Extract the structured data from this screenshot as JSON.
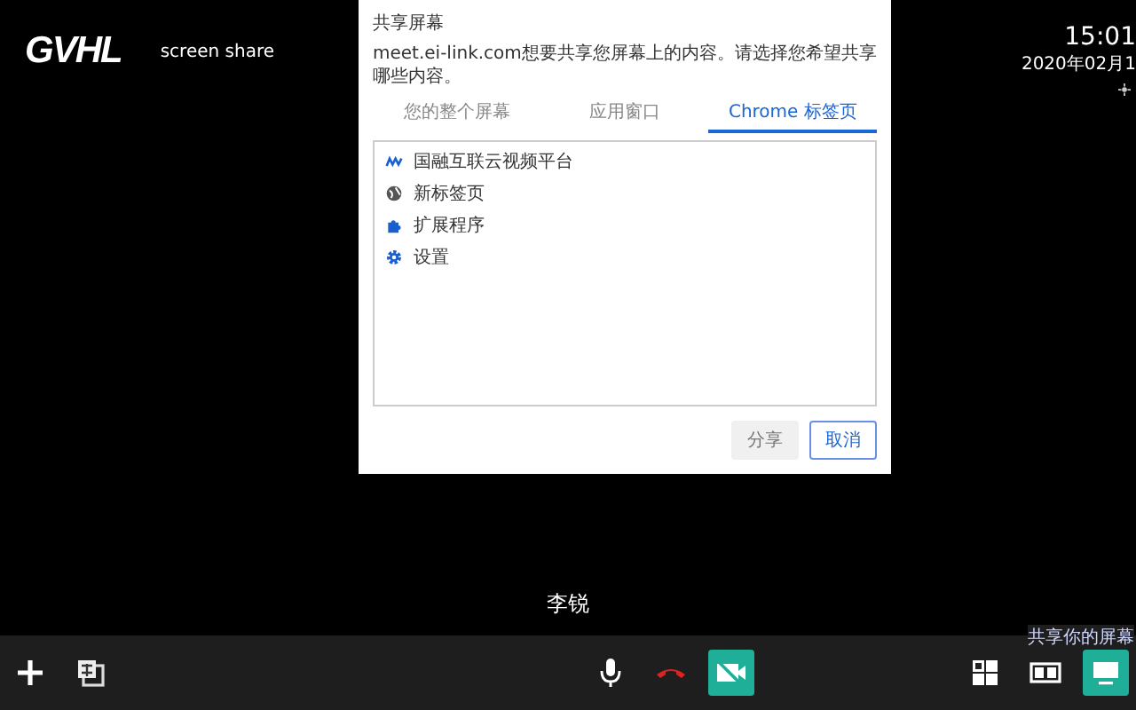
{
  "header": {
    "logo": "GVHL",
    "title": "screen share",
    "time": "15:01",
    "date": "2020年02月1"
  },
  "dialog": {
    "title": "共享屏幕",
    "description": "meet.ei-link.com想要共享您屏幕上的内容。请选择您希望共享哪些内容。",
    "tabs": [
      {
        "label": "您的整个屏幕",
        "selected": false
      },
      {
        "label": "应用窗口",
        "selected": false
      },
      {
        "label": "Chrome 标签页",
        "selected": true
      }
    ],
    "items": [
      {
        "kind": "logo",
        "label": "国融互联云视频平台"
      },
      {
        "kind": "globe",
        "label": "新标签页"
      },
      {
        "kind": "puzzle",
        "label": "扩展程序"
      },
      {
        "kind": "gear",
        "label": "设置"
      }
    ],
    "buttons": [
      {
        "label": "分享",
        "disabled": true
      },
      {
        "label": "取消",
        "disabled": false
      }
    ]
  },
  "participant": "李锐",
  "toolbar": {
    "left": [
      {
        "kind": "add"
      },
      {
        "kind": "copy"
      }
    ],
    "center": [
      {
        "kind": "mic",
        "on": false
      },
      {
        "kind": "hangup",
        "on": false
      },
      {
        "kind": "camera-off",
        "on": true
      }
    ],
    "right": [
      {
        "kind": "grid",
        "on": false
      },
      {
        "kind": "split",
        "on": false
      },
      {
        "kind": "screen",
        "on": true
      }
    ],
    "tooltip": "共享你的屏幕"
  }
}
